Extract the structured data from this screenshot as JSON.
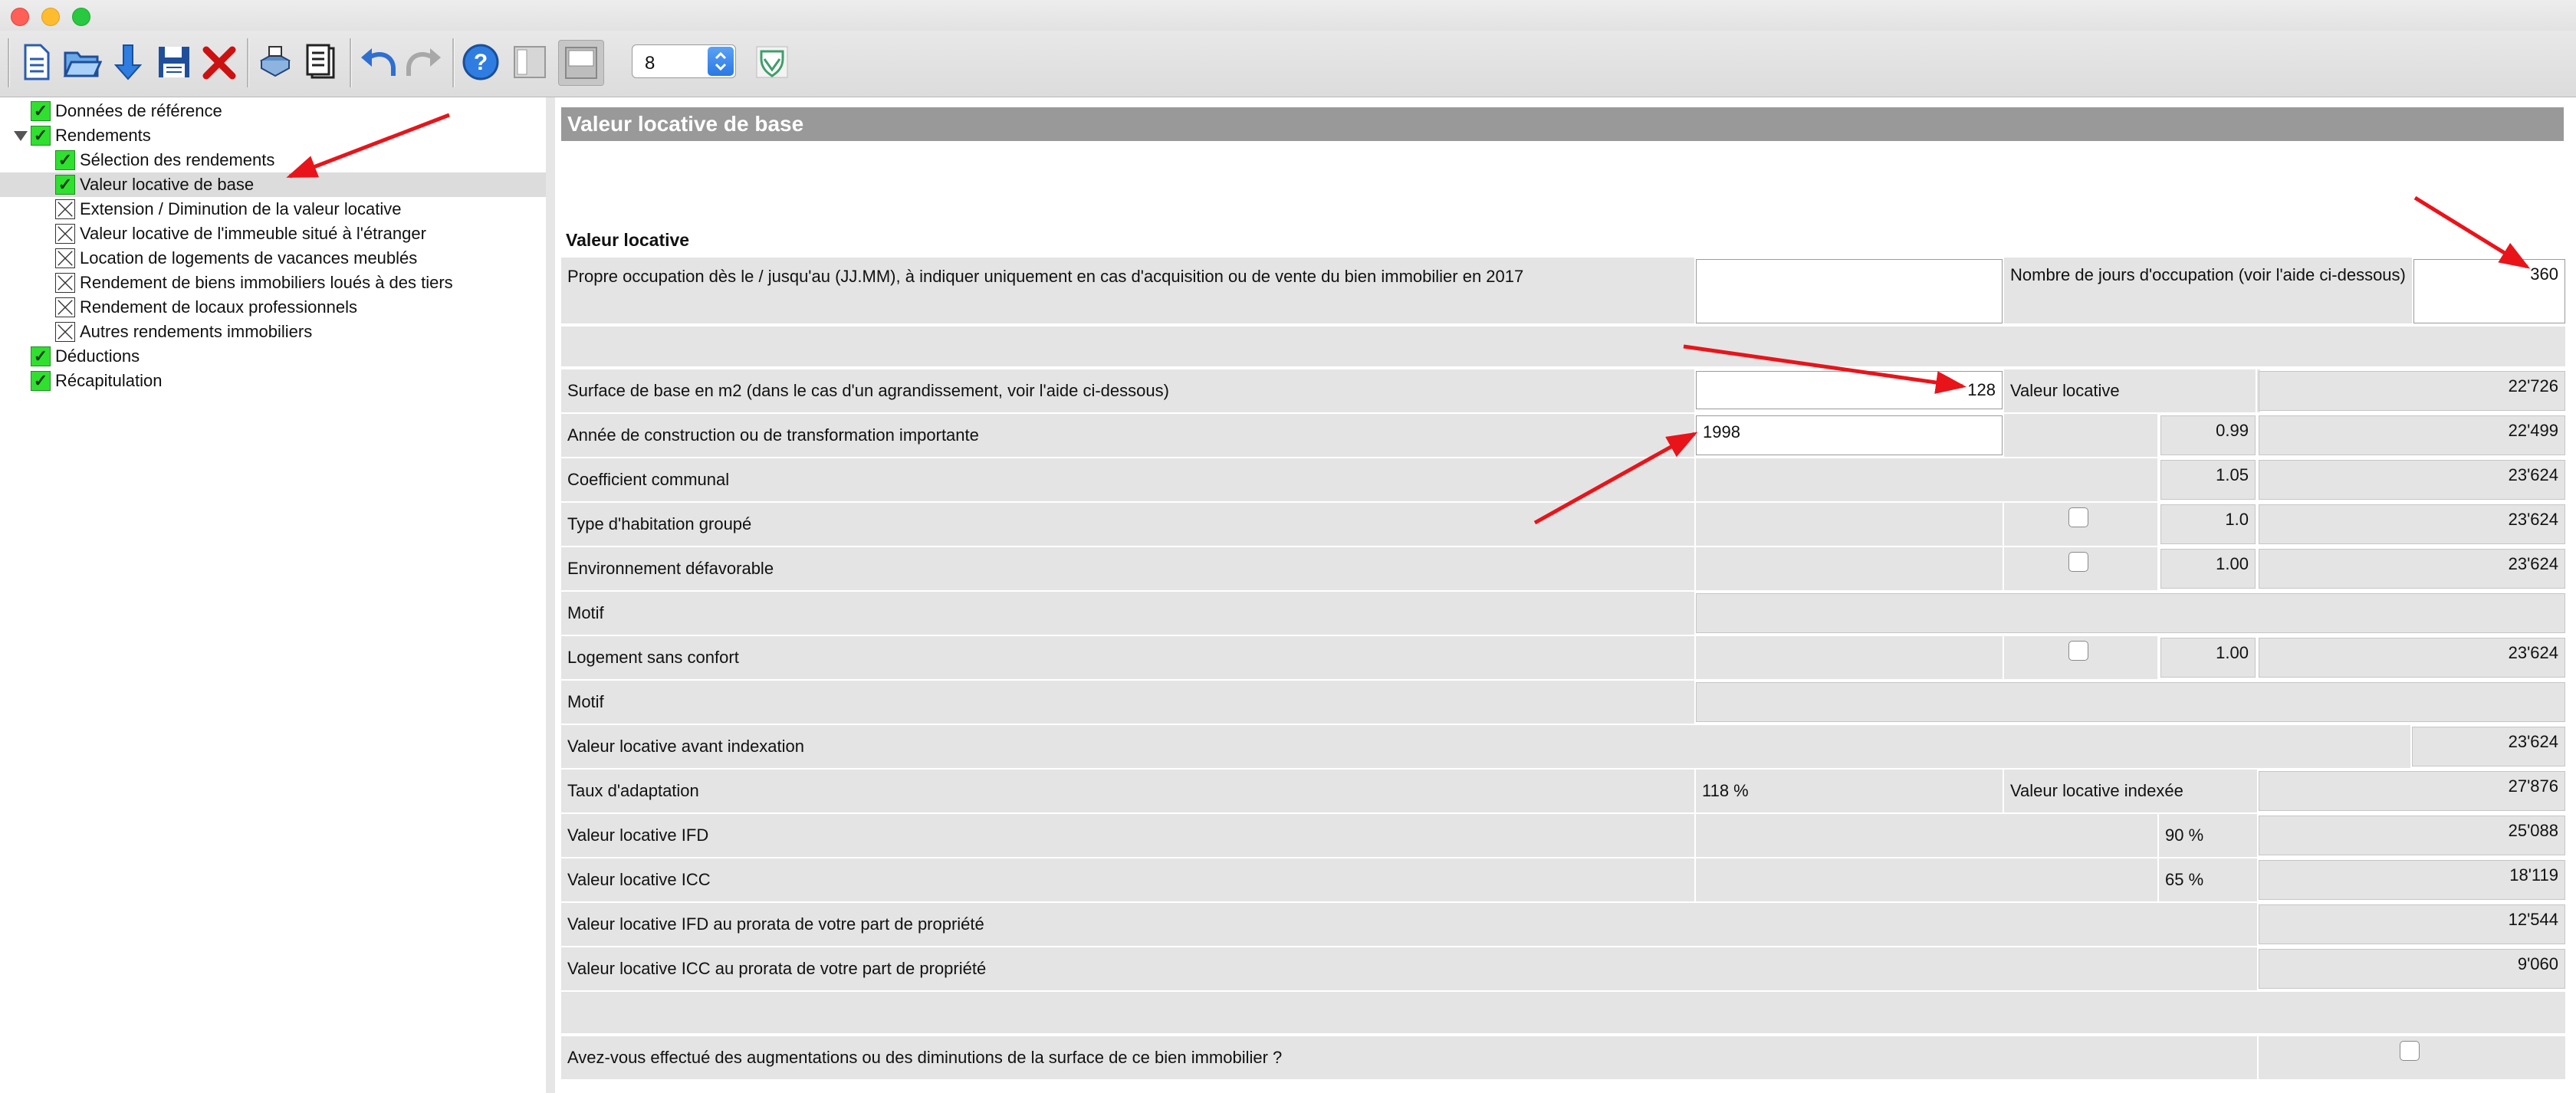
{
  "toolbar": {
    "buttons": [
      "new-document-icon",
      "open-folder-icon",
      "download-arrow-icon",
      "save-disk-icon",
      "delete-x-icon",
      "print-icon",
      "document-form-icon",
      "undo-icon",
      "redo-icon",
      "help-icon",
      "layout-single-icon",
      "layout-split-icon"
    ],
    "zoom_value": "8",
    "badge_icon": "shield-badge-icon"
  },
  "sidebar": {
    "items": [
      {
        "label": "Données de référence",
        "status": "check"
      },
      {
        "label": "Rendements",
        "status": "check"
      },
      {
        "label": "Sélection des rendements",
        "status": "check"
      },
      {
        "label": "Valeur locative de base",
        "status": "check"
      },
      {
        "label": "Extension / Diminution de la valeur locative",
        "status": "cross"
      },
      {
        "label": "Valeur locative de l'immeuble situé à l'étranger",
        "status": "cross"
      },
      {
        "label": "Location de logements de vacances meublés",
        "status": "cross"
      },
      {
        "label": "Rendement de biens immobiliers loués à des tiers",
        "status": "cross"
      },
      {
        "label": "Rendement de locaux professionnels",
        "status": "cross"
      },
      {
        "label": "Autres rendements immobiliers",
        "status": "cross"
      },
      {
        "label": "Déductions",
        "status": "check"
      },
      {
        "label": "Récapitulation",
        "status": "check"
      }
    ]
  },
  "main": {
    "header": "Valeur locative de base",
    "section": "Valeur locative",
    "occupation_label": "Propre occupation dès le / jusqu'au (JJ.MM), à indiquer uniquement en cas d'acquisition ou de vente du bien immobilier en 2017",
    "occupation_value": "",
    "days_label": "Nombre de jours d'occupation (voir l'aide ci-dessous)",
    "days_value": "360",
    "surface_label": "Surface de base en m2 (dans le cas d'un agrandissement, voir l'aide ci-dessous)",
    "surface_value": "128",
    "valeur_locative_label": "Valeur locative",
    "valeur_locative_value": "22'726",
    "annee_label": "Année de construction ou de transformation importante",
    "annee_value": "1998",
    "annee_coef": "0.99",
    "annee_result": "22'499",
    "coef_communal_label": "Coefficient communal",
    "coef_communal_value": "1.05",
    "coef_communal_result": "23'624",
    "type_hab_label": "Type d'habitation groupé",
    "type_hab_coef": "1.0",
    "type_hab_result": "23'624",
    "env_label": "Environnement défavorable",
    "env_coef": "1.00",
    "env_result": "23'624",
    "motif_label": "Motif",
    "motif_value": "",
    "sans_confort_label": "Logement sans confort",
    "sans_confort_coef": "1.00",
    "sans_confort_result": "23'624",
    "motif2_label": "Motif",
    "motif2_value": "",
    "avant_index_label": "Valeur locative avant indexation",
    "avant_index_value": "23'624",
    "taux_label": "Taux d'adaptation",
    "taux_value": "118 %",
    "indexee_label": "Valeur locative indexée",
    "indexee_value": "27'876",
    "ifd_label": "Valeur locative IFD",
    "ifd_pct": "90 %",
    "ifd_value": "25'088",
    "icc_label": "Valeur locative ICC",
    "icc_pct": "65 %",
    "icc_value": "18'119",
    "ifd_prorata_label": "Valeur locative IFD au prorata de votre part de propriété",
    "ifd_prorata_value": "12'544",
    "icc_prorata_label": "Valeur locative ICC au prorata de votre part de propriété",
    "icc_prorata_value": "9'060",
    "question_label": "Avez-vous effectué des augmentations ou des diminutions de la surface de ce bien immobilier ?"
  },
  "colors": {
    "annotation_arrow": "#e8141a",
    "check_green": "#2fe02f",
    "header_gray": "#999999"
  }
}
